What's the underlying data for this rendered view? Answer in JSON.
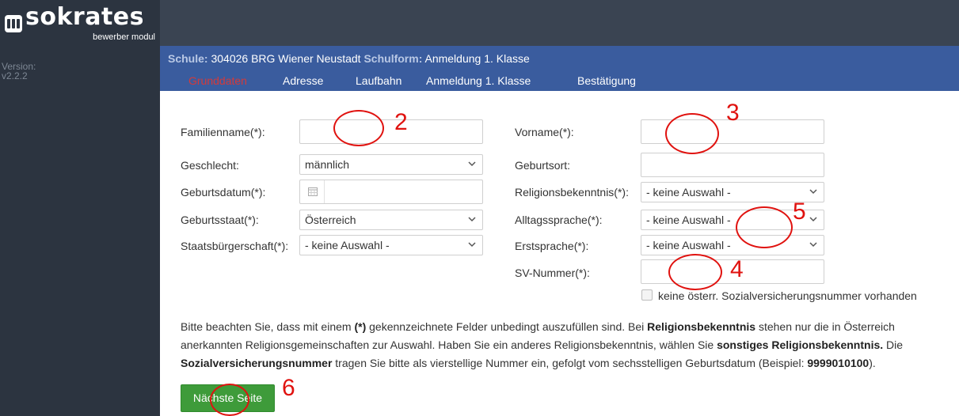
{
  "app": {
    "logo_text": "sokrates",
    "logo_sub": "bewerber modul"
  },
  "sidebar": {
    "version_label": "Version:",
    "version_value": "v2.2.2"
  },
  "header": {
    "school_label": "Schule:",
    "school_value": "304026 BRG Wiener Neustadt",
    "type_label": "Schulform:",
    "type_value": "Anmeldung 1. Klasse"
  },
  "tabs": [
    {
      "label": "Grunddaten",
      "active": true
    },
    {
      "label": "Adresse"
    },
    {
      "label": "Laufbahn"
    },
    {
      "label": "Anmeldung 1. Klasse"
    },
    {
      "label": "Bestätigung"
    }
  ],
  "form": {
    "familienname": {
      "label": "Familienname(*):",
      "value": ""
    },
    "vorname": {
      "label": "Vorname(*):",
      "value": ""
    },
    "geschlecht": {
      "label": "Geschlecht:",
      "value": "männlich"
    },
    "geburtsort": {
      "label": "Geburtsort:",
      "value": ""
    },
    "geburtsdatum": {
      "label": "Geburtsdatum(*):",
      "value": ""
    },
    "religion": {
      "label": "Religionsbekenntnis(*):",
      "value": "- keine Auswahl -"
    },
    "geburtsstaat": {
      "label": "Geburtsstaat(*):",
      "value": "Österreich"
    },
    "alltagssprache": {
      "label": "Alltagssprache(*):",
      "value": "- keine Auswahl -"
    },
    "staatsbuergerschaft": {
      "label": "Staatsbürgerschaft(*):",
      "value": "- keine Auswahl -"
    },
    "erstsprache": {
      "label": "Erstsprache(*):",
      "value": "- keine Auswahl -"
    },
    "sv_nummer": {
      "label": "SV-Nummer(*):",
      "value": ""
    },
    "no_sv_checkbox": {
      "label": "keine österr. Sozialversicherungsnummer vorhanden",
      "checked": false
    }
  },
  "note": {
    "p1": "Bitte beachten Sie, dass mit einem ",
    "p1b": "(*)",
    "p2": " gekennzeichnete Felder unbedingt auszufüllen sind. Bei ",
    "p2b": "Religionsbekenntnis",
    "p3": " stehen nur die in Österreich anerkannten Religionsgemeinschaften zur Auswahl. Haben Sie ein anderes Religionsbekenntnis, wählen Sie ",
    "p3b": "sonstiges Religionsbekenntnis.",
    "p4": " Die ",
    "p4b": "Sozialversicherungsnummer",
    "p5": " tragen Sie bitte als vierstellige Nummer ein, gefolgt vom sechsstelligen Geburtsdatum (Beispiel: ",
    "p5b": "9999010100",
    "p6": ")."
  },
  "next_button": {
    "label": "Nächste Seite"
  },
  "annotations": {
    "n2": "2",
    "n3": "3",
    "n4": "4",
    "n5": "5",
    "n6": "6"
  },
  "colors": {
    "header_blue": "#3a5c9e",
    "sidebar_dark": "#2c3440",
    "active_tab": "#d43a3a",
    "button_green": "#3e9b3a",
    "annotation_red": "#e0120f"
  }
}
